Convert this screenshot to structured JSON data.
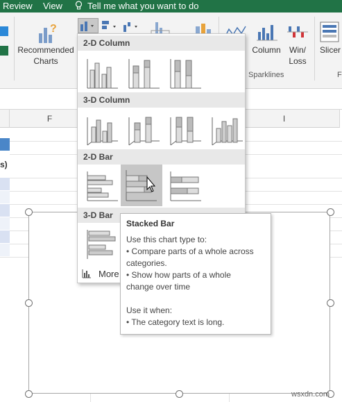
{
  "topbar": {
    "review": "Review",
    "view": "View",
    "tellme": "Tell me what you want to do"
  },
  "ribbon": {
    "recommended_charts": [
      "Recommended",
      "Charts"
    ],
    "column": "Column",
    "win_loss": [
      "Win/",
      "Loss"
    ],
    "slicer": "Slicer",
    "sparklines": "Sparklines",
    "filter_partial": "F"
  },
  "sheet": {
    "col_f": "F",
    "col_i": "I",
    "cell_partial": "s)"
  },
  "dropdown": {
    "sections": [
      "2-D Column",
      "3-D Column",
      "2-D Bar",
      "3-D Bar"
    ],
    "more": "More"
  },
  "tooltip": {
    "title": "Stacked Bar",
    "lines": [
      "Use this chart type to:",
      "• Compare parts of a whole across",
      "categories.",
      "• Show how parts of a whole",
      "change over time"
    ],
    "lines2": [
      "Use it when:",
      "• The category text is long."
    ]
  },
  "watermark": "wsxdn.com",
  "colors": {
    "excel_green": "#217346",
    "selected_bg": "#c6c6c6",
    "section_bg": "#e8e8e8"
  }
}
